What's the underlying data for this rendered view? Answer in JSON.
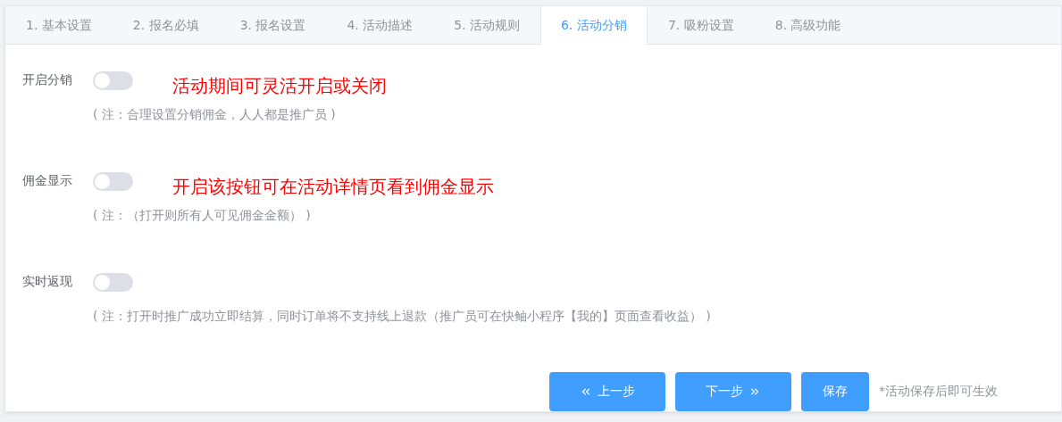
{
  "tabs": [
    {
      "label": "1. 基本设置",
      "selected": false
    },
    {
      "label": "2. 报名必填",
      "selected": false
    },
    {
      "label": "3. 报名设置",
      "selected": false
    },
    {
      "label": "4. 活动描述",
      "selected": false
    },
    {
      "label": "5. 活动规则",
      "selected": false
    },
    {
      "label": "6. 活动分销",
      "selected": true
    },
    {
      "label": "7. 吸粉设置",
      "selected": false
    },
    {
      "label": "8. 高级功能",
      "selected": false
    }
  ],
  "settings": [
    {
      "label": "开启分销",
      "on": false,
      "annotation": "活动期间可灵活开启或关闭",
      "note": "( 注：合理设置分销佣金，人人都是推广员 )"
    },
    {
      "label": "佣金显示",
      "on": false,
      "annotation": "开启该按钮可在活动详情页看到佣金显示",
      "note": "( 注：（打开则所有人可见佣金金额） )"
    },
    {
      "label": "实时返现",
      "on": false,
      "note": "( 注：打开时推广成功立即结算，同时订单将不支持线上退款（推广员可在快鲉小程序【我的】页面查看收益） )"
    }
  ],
  "buttons": [
    {
      "kind": "prev",
      "label": "上一步"
    },
    {
      "kind": "next",
      "label": "下一步"
    },
    {
      "kind": "save",
      "label": "保存"
    }
  ],
  "hint": "*活动保存后即可生效"
}
